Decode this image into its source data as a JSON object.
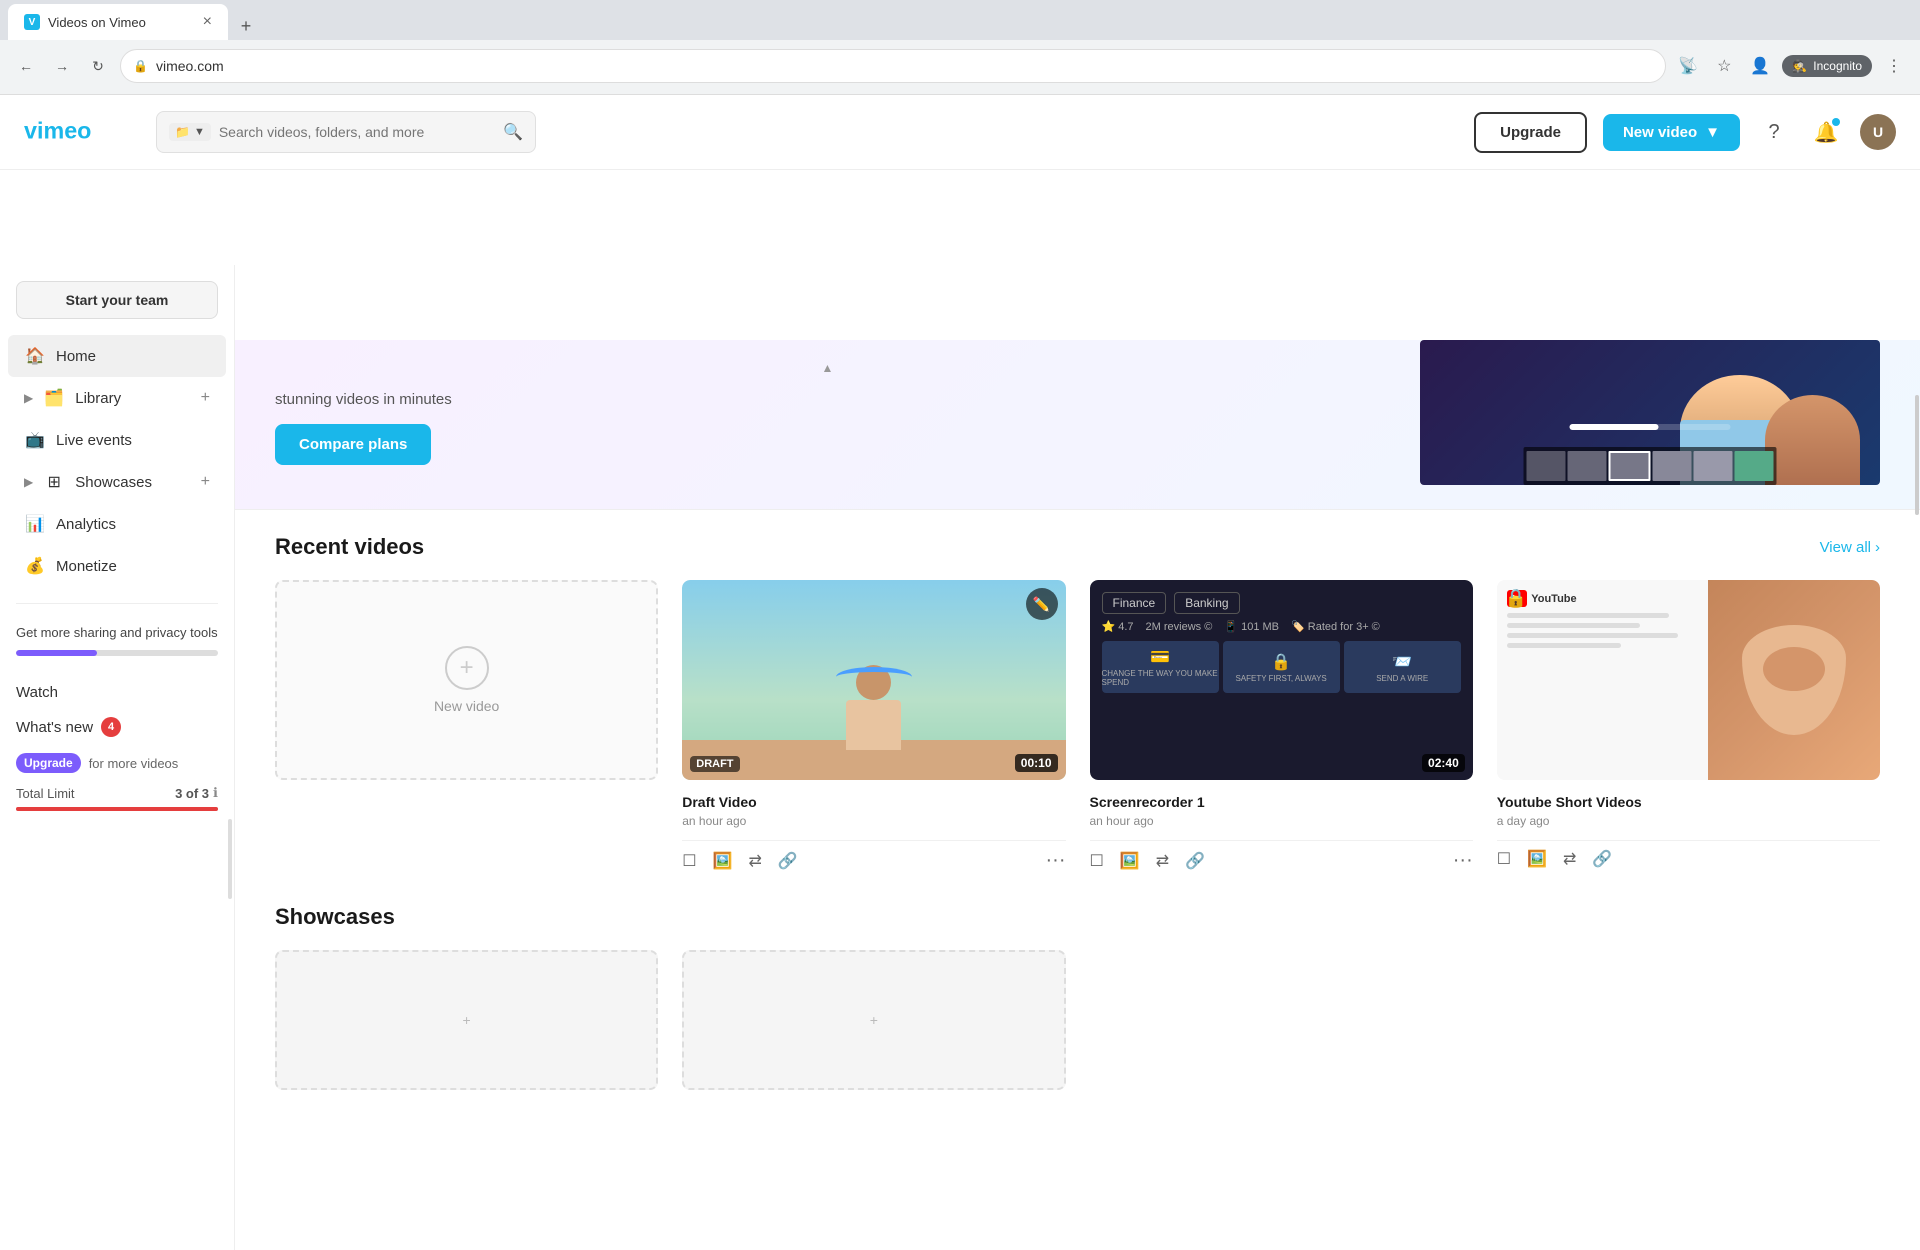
{
  "browser": {
    "tab_favicon": "V",
    "tab_title": "Videos on Vimeo",
    "url": "vimeo.com",
    "incognito_label": "Incognito"
  },
  "header": {
    "logo_text": "vimeo",
    "search_placeholder": "Search videos, folders, and more",
    "upgrade_label": "Upgrade",
    "new_video_label": "New video"
  },
  "sidebar": {
    "start_team_label": "Start your team",
    "nav_items": [
      {
        "label": "Home",
        "icon": "🏠"
      },
      {
        "label": "Library",
        "icon": "📚",
        "expandable": true
      },
      {
        "label": "Live events",
        "icon": "📺"
      },
      {
        "label": "Showcases",
        "icon": "🗂️",
        "expandable": true
      },
      {
        "label": "Analytics",
        "icon": "📊"
      },
      {
        "label": "Monetize",
        "icon": "💰"
      }
    ],
    "promo_text": "Get more sharing and privacy tools",
    "upgrade_pill": "Upgrade",
    "watch_label": "Watch",
    "whats_new_label": "What's new",
    "whats_new_badge": "4",
    "upgrade_more_label": "for more videos",
    "total_limit_label": "Total Limit",
    "limit_value": "3 of 3"
  },
  "banner": {
    "subtitle": "stunning videos in minutes",
    "compare_plans_label": "Compare plans"
  },
  "recent_videos": {
    "section_title": "Recent videos",
    "view_all_label": "View all",
    "new_video_card_label": "New video",
    "videos": [
      {
        "title": "Draft Video",
        "time": "an hour ago",
        "duration": "00:10",
        "type": "draft",
        "has_edit_icon": true
      },
      {
        "title": "Screenrecorder 1",
        "time": "an hour ago",
        "duration": "02:40",
        "type": "finance"
      },
      {
        "title": "Youtube Short Videos",
        "time": "a day ago",
        "type": "youtube",
        "locked": true
      }
    ]
  },
  "showcases": {
    "section_title": "Showcases"
  }
}
